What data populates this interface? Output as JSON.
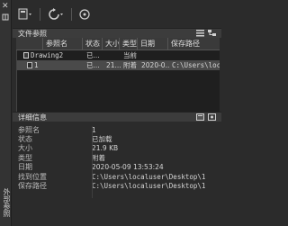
{
  "leftbar": {
    "close_glyph": "✕",
    "vertical_title": "外部参照"
  },
  "toolbar": {
    "buttons": [
      {
        "icon": "attach-file-icon"
      },
      {
        "icon": "refresh-icon"
      },
      {
        "icon": "help-icon"
      }
    ]
  },
  "file_refs": {
    "title": "文件参照",
    "columns": [
      "参照名",
      "状态",
      "大小",
      "类型",
      "日期",
      "保存路径"
    ],
    "rows": [
      {
        "name": "Drawing2",
        "status": "已...",
        "size": "",
        "type": "当前",
        "date": "",
        "path": ""
      },
      {
        "name": "1",
        "status": "已...",
        "size": "21...",
        "type": "附着",
        "date": "2020-0...",
        "path": "C:\\Users\\local"
      }
    ]
  },
  "details": {
    "title": "详细信息",
    "fields": [
      {
        "label": "参照名",
        "value": "1"
      },
      {
        "label": "状态",
        "value": "已加载"
      },
      {
        "label": "大小",
        "value": "21.9 KB"
      },
      {
        "label": "类型",
        "value": "附着"
      },
      {
        "label": "日期",
        "value": "2020-05-09 13:53:24"
      },
      {
        "label": "找到位置",
        "value": "C:\\Users\\localuser\\Desktop\\1"
      },
      {
        "label": "保存路径",
        "value": "C:\\Users\\localuser\\Desktop\\1"
      }
    ]
  },
  "colors": {
    "panel_bg": "#2b2b2b",
    "header_bg": "#3c3c3c",
    "selected_row": "#4a4a4a"
  }
}
